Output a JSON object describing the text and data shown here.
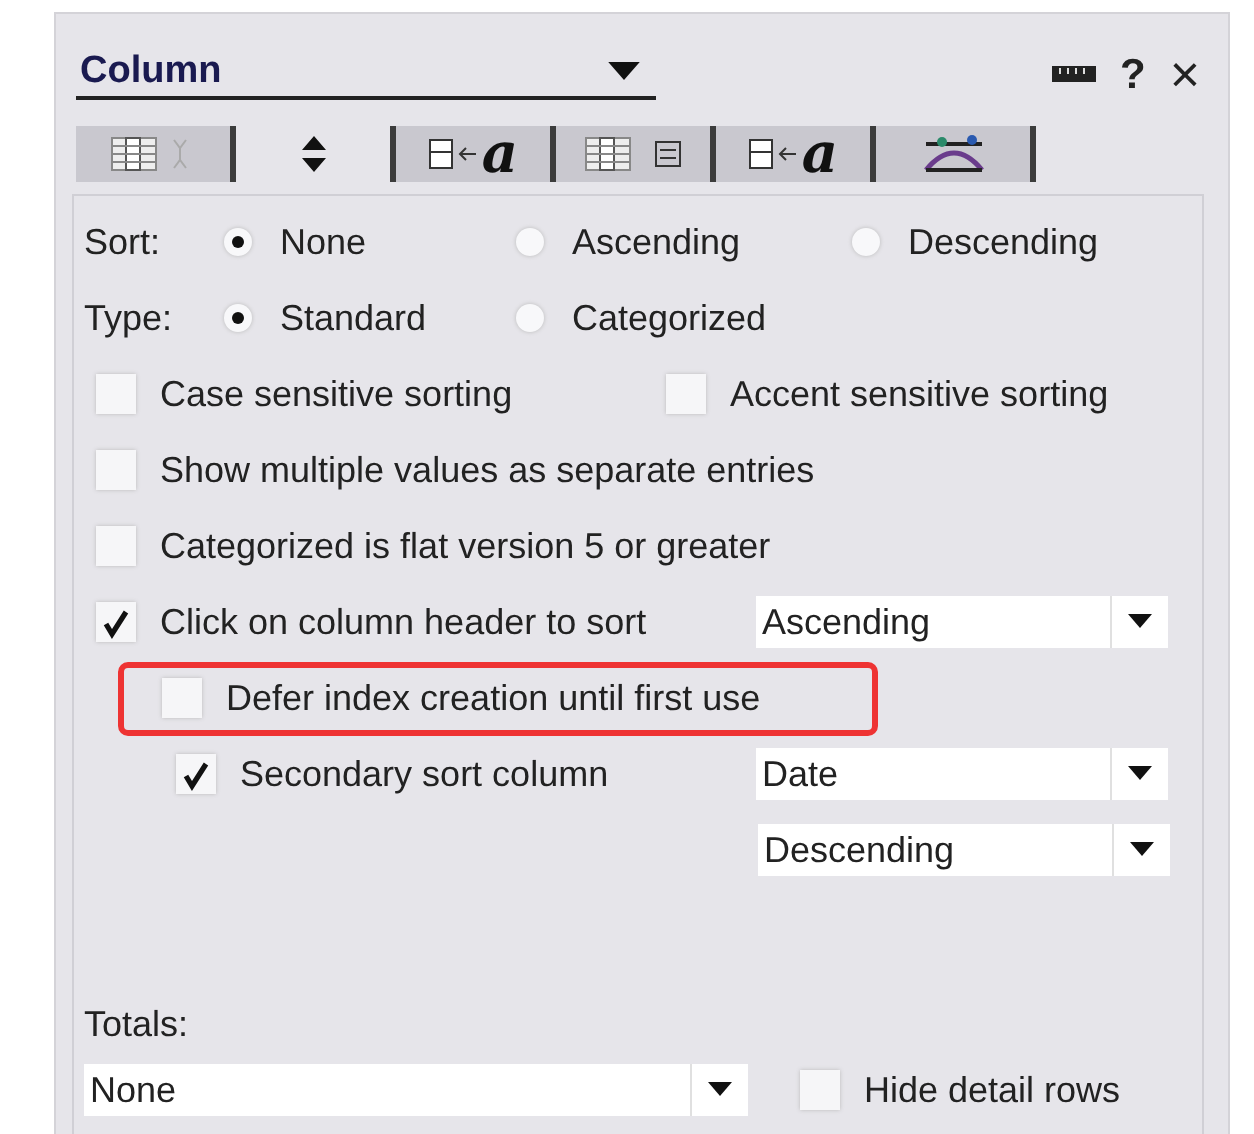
{
  "header": {
    "title": "Column",
    "help": "?",
    "close": "×"
  },
  "tabs": [
    {
      "selected": false
    },
    {
      "selected": true
    },
    {
      "glyph": "a",
      "selected": false
    },
    {
      "selected": false
    },
    {
      "glyph": "a",
      "selected": false
    },
    {
      "selected": false
    }
  ],
  "sort": {
    "label": "Sort:",
    "options": [
      {
        "label": "None",
        "selected": true
      },
      {
        "label": "Ascending",
        "selected": false
      },
      {
        "label": "Descending",
        "selected": false
      }
    ]
  },
  "type": {
    "label": "Type:",
    "options": [
      {
        "label": "Standard",
        "selected": true
      },
      {
        "label": "Categorized",
        "selected": false
      }
    ]
  },
  "checkbox_rows": [
    {
      "items": [
        {
          "label": "Case sensitive sorting",
          "checked": false
        },
        {
          "label": "Accent sensitive sorting",
          "checked": false
        }
      ]
    },
    {
      "items": [
        {
          "label": "Show multiple values as separate entries",
          "checked": false
        }
      ]
    },
    {
      "items": [
        {
          "label": "Categorized is flat version 5 or greater",
          "checked": false
        }
      ]
    }
  ],
  "header_sort": {
    "label": "Click on column header to sort",
    "checked": true,
    "dropdown": "Ascending",
    "children": [
      {
        "label": "Defer index creation until first use",
        "checked": false,
        "highlighted": true
      },
      {
        "label": "Secondary sort column",
        "checked": true,
        "highlighted": false,
        "dropdowns": [
          "Date",
          "Descending"
        ]
      }
    ]
  },
  "totals": {
    "label": "Totals:",
    "dropdown": "None",
    "hide_detail": {
      "label": "Hide detail rows",
      "checked": false
    }
  }
}
